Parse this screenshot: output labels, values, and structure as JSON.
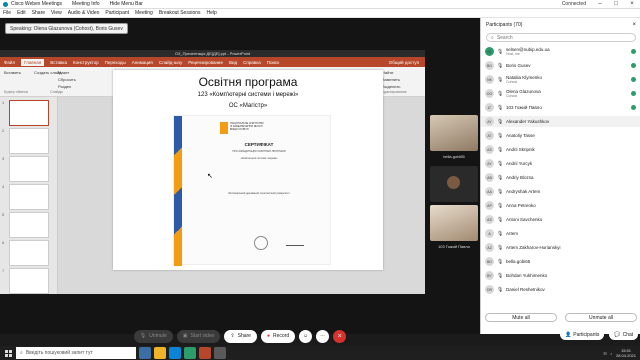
{
  "window": {
    "app_title": "Cisco Webex Meetings",
    "meeting_info": "Meeting Info",
    "hide_menu_bar": "Hide Menu Bar",
    "connected": "Connected"
  },
  "menu": [
    "File",
    "Edit",
    "Share",
    "View",
    "Audio & Video",
    "Participant",
    "Meeting",
    "Breakout Sessions",
    "Help"
  ],
  "speaking": "Speaking: Olena Glazunova (Cohost), Boris Gusev",
  "ppt": {
    "title": "ОЗ_Презентація ДЕ[ДЕ].ppt - PowerPoint",
    "tabs": [
      "Файл",
      "Главная",
      "Вставка",
      "Конструктор",
      "Переходы",
      "Анимация",
      "Слайд-шоу",
      "Рецензирование",
      "Вид",
      "Справка",
      "Поиск"
    ],
    "share": "Общий доступ",
    "ribbon": {
      "paste": "Вставить",
      "create_slide": "Создать слайд",
      "reset": "Сбросить",
      "section": "Раздел",
      "layout": "Макет",
      "clipboard": "Буфер обмена",
      "slides": "Слайды",
      "font": "Шрифт",
      "paragraph": "Абзац",
      "drawing": "Рисование",
      "arrange": "Упорядочить",
      "quick_styles": "Экспресс-стили",
      "fill": "Заливка фигуры",
      "outline": "Контур фигуры",
      "effects": "Эффекты фигуры",
      "find": "Найти",
      "replace": "Заменить",
      "select": "Выделить",
      "editing": "Редактирование"
    },
    "thumb_numbers": [
      "1",
      "2",
      "3",
      "4",
      "5",
      "6",
      "7"
    ]
  },
  "slide": {
    "title": "Освітня програма",
    "subtitle1": "123 «Комп'ютерні системи і мережі»",
    "subtitle2": "ОС «Магістр»",
    "cert": {
      "logo_text": "НАЦІОНАЛЬНЕ АГЕНТСТВО ІЗ ЗАБЕЗПЕЧЕННЯ ЯКОСТІ ВИЩОЇ ОСВІТИ",
      "heading": "СЕРТИФІКАТ",
      "line1": "ПРО АКРЕДИТАЦІЮ ОСВІТНЬОЇ ПРОГРАМИ",
      "line2": "«Комп'ютерні системи і мережі»",
      "line3": "Житомирський державний технологічний університет"
    }
  },
  "videos": [
    {
      "name": "bella.gobi65"
    },
    {
      "name": ""
    },
    {
      "name": "103 Гожий Павло"
    }
  ],
  "participants": {
    "header": "Participants (70)",
    "search_placeholder": "Search",
    "list": [
      {
        "initials": "SE",
        "name": "selsen@nubip.edu.ua",
        "sub": "Host, me",
        "color": "#2c9c6b"
      },
      {
        "initials": "BG",
        "name": "Boris Gusev",
        "sub": "",
        "color": "#d8d8d8"
      },
      {
        "initials": "NK",
        "name": "Nataliia Klymenko",
        "sub": "Cohost",
        "color": "#d8d8d8"
      },
      {
        "initials": "OG",
        "name": "Olena Glazunova",
        "sub": "Cohost",
        "color": "#d8d8d8"
      },
      {
        "initials": "1Г",
        "name": "103 Гожий Павло",
        "sub": "",
        "color": "#d8d8d8"
      },
      {
        "initials": "AY",
        "name": "Alexander Yakushkov",
        "sub": "",
        "color": "#d8d8d8"
      },
      {
        "initials": "AT",
        "name": "Anatoliy Tasse",
        "sub": "",
        "color": "#d8d8d8"
      },
      {
        "initials": "AS",
        "name": "Andrii Skripnik",
        "sub": "",
        "color": "#d8d8d8"
      },
      {
        "initials": "AY",
        "name": "Andrii Yurcyk",
        "sub": "",
        "color": "#d8d8d8"
      },
      {
        "initials": "AB",
        "name": "Andriy Blozsa",
        "sub": "",
        "color": "#d8d8d8"
      },
      {
        "initials": "AA",
        "name": "Andryshak Artem",
        "sub": "",
        "color": "#d8d8d8"
      },
      {
        "initials": "AP",
        "name": "Anna Petrenko",
        "sub": "",
        "color": "#d8d8d8"
      },
      {
        "initials": "AS",
        "name": "Antoni Savchenko",
        "sub": "",
        "color": "#d8d8d8"
      },
      {
        "initials": "A",
        "name": "Artem",
        "sub": "",
        "color": "#d8d8d8"
      },
      {
        "initials": "AZ",
        "name": "Artem Zakharov-Horianskyi",
        "sub": "",
        "color": "#d8d8d8"
      },
      {
        "initials": "BG",
        "name": "bella.gobi65",
        "sub": "",
        "color": "#d8d8d8"
      },
      {
        "initials": "BY",
        "name": "Bohdan Yukhimenko",
        "sub": "",
        "color": "#d8d8d8"
      },
      {
        "initials": "DR",
        "name": "Daniel Reshetnikov",
        "sub": "",
        "color": "#d8d8d8"
      }
    ],
    "mute_all": "Mute all",
    "unmute_all": "Unmute all"
  },
  "controls": {
    "unmute": "Unmute",
    "start_video": "Start video",
    "share": "Share",
    "record": "Record",
    "participants_btn": "Participants",
    "chat_btn": "Chat"
  },
  "taskbar": {
    "search_placeholder": "Введіть пошуковий запит тут",
    "time": "15:51",
    "date": "28.04.2021"
  },
  "colors": {
    "ppt_accent": "#b7472a",
    "end_call": "#d6332e",
    "cert_blue": "#2d5ba8",
    "cert_orange": "#f39c12"
  }
}
